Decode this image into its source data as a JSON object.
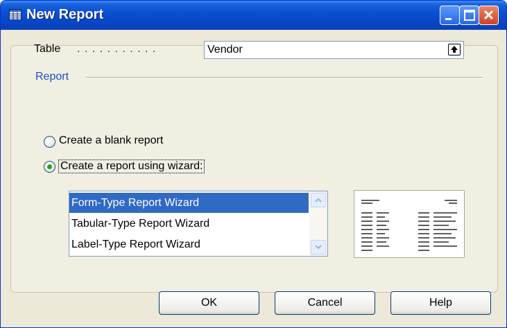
{
  "window": {
    "title": "New Report",
    "icon": "report-table-icon",
    "controls": [
      "minimize-icon",
      "maximize-icon",
      "close-icon"
    ]
  },
  "table": {
    "label": "Table",
    "dots": ". . . . . . . . . . .",
    "value": "Vendor",
    "lookup_icon": "lookup-arrow-icon"
  },
  "report": {
    "group_label": "Report",
    "options": [
      {
        "label": "Create a blank report",
        "selected": false
      },
      {
        "label": "Create a report using wizard:",
        "selected": true
      }
    ]
  },
  "wizard_list": {
    "items": [
      {
        "label": "Form-Type Report Wizard",
        "selected": true
      },
      {
        "label": "Tabular-Type Report Wizard",
        "selected": false
      },
      {
        "label": "Label-Type Report Wizard",
        "selected": false
      }
    ]
  },
  "buttons": {
    "ok": "OK",
    "cancel": "Cancel",
    "help": "Help"
  },
  "colors": {
    "title_bar": "#0a4fd4",
    "selection": "#316ac5",
    "group_label": "#1a4fd0",
    "dialog_bg": "#ece9d8",
    "close_button": "#d0411e"
  }
}
